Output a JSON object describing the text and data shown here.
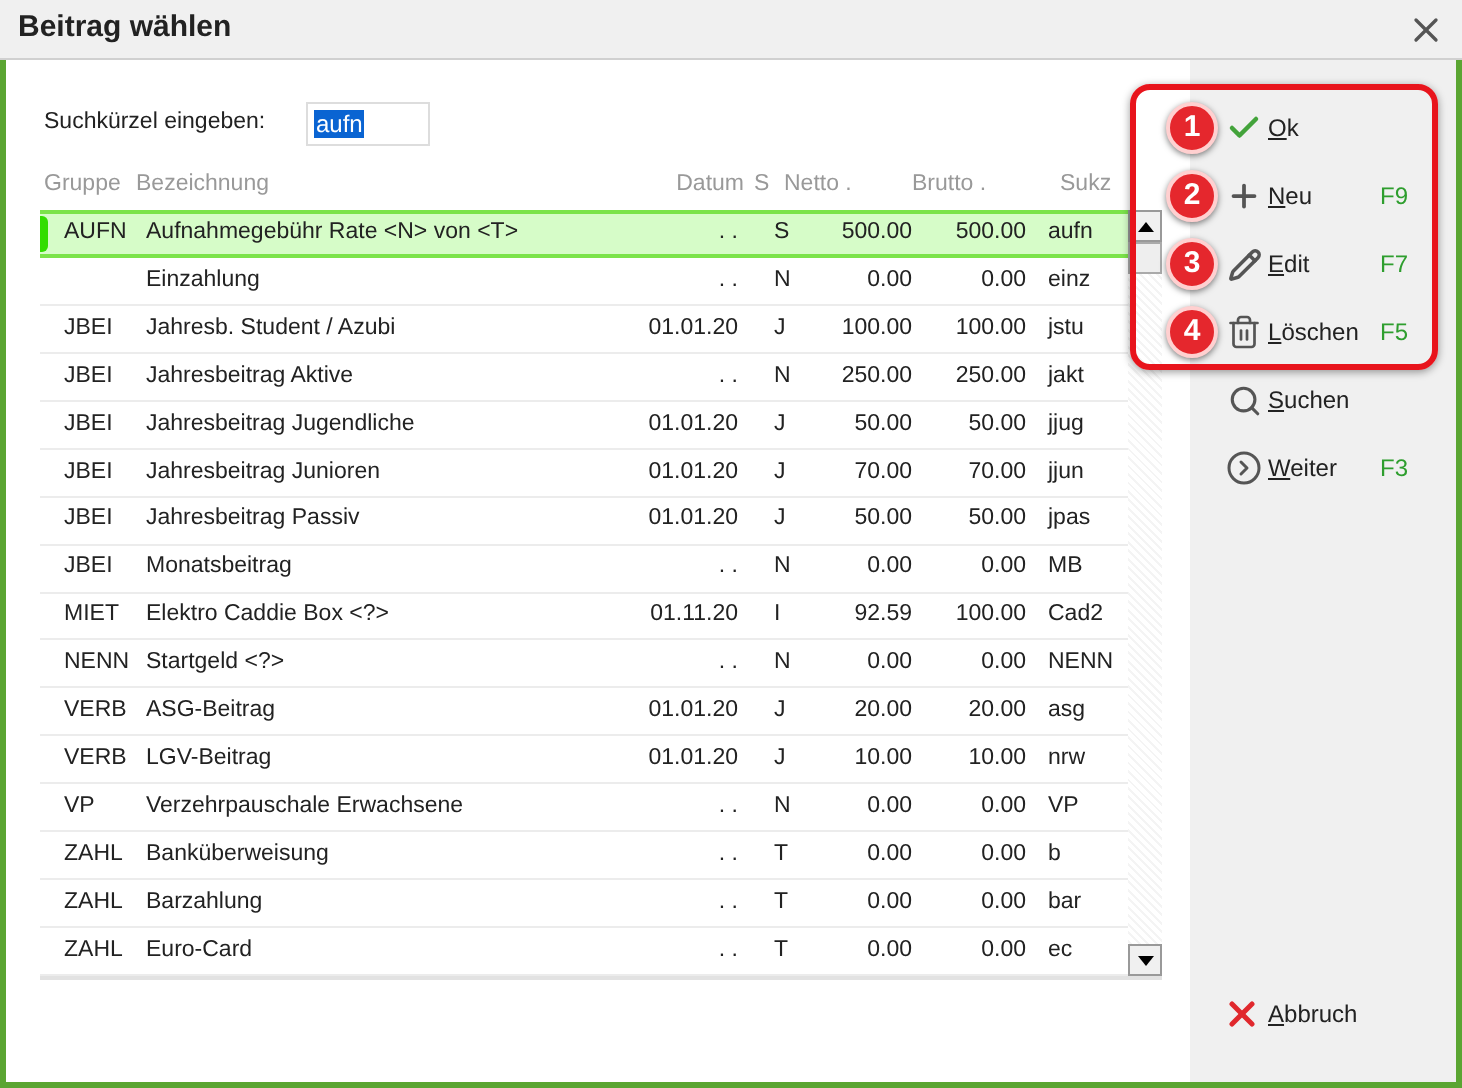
{
  "window": {
    "title": "Beitrag wählen"
  },
  "search": {
    "label": "Suchkürzel eingeben:",
    "value": "aufn"
  },
  "table": {
    "columns": [
      "Gruppe",
      "Bezeichnung",
      "Datum",
      "S",
      "Netto .",
      "Brutto .",
      "Sukz"
    ],
    "rows": [
      {
        "selected": true,
        "cells": [
          "AUFN",
          "Aufnahmegebühr Rate <N> von <T>",
          ". .",
          "S",
          "500.00",
          "500.00",
          "aufn"
        ]
      },
      {
        "selected": false,
        "cells": [
          "",
          "Einzahlung",
          ". .",
          "N",
          "0.00",
          "0.00",
          "einz"
        ]
      },
      {
        "selected": false,
        "cells": [
          "JBEI",
          "Jahresb. Student / Azubi",
          "01.01.20",
          "J",
          "100.00",
          "100.00",
          "jstu"
        ]
      },
      {
        "selected": false,
        "cells": [
          "JBEI",
          "Jahresbeitrag Aktive",
          ". .",
          "N",
          "250.00",
          "250.00",
          "jakt"
        ]
      },
      {
        "selected": false,
        "cells": [
          "JBEI",
          "Jahresbeitrag Jugendliche",
          "01.01.20",
          "J",
          "50.00",
          "50.00",
          "jjug"
        ]
      },
      {
        "selected": false,
        "cells": [
          "JBEI",
          "Jahresbeitrag Junioren",
          "01.01.20",
          "J",
          "70.00",
          "70.00",
          "jjun"
        ]
      },
      {
        "selected": false,
        "cells": [
          "JBEI",
          "Jahresbeitrag Passiv",
          "01.01.20",
          "J",
          "50.00",
          "50.00",
          "jpas"
        ]
      },
      {
        "selected": false,
        "cells": [
          "JBEI",
          "Monatsbeitrag",
          ". .",
          "N",
          "0.00",
          "0.00",
          "MB"
        ]
      },
      {
        "selected": false,
        "cells": [
          "MIET",
          "Elektro Caddie Box <?>",
          "01.11.20",
          "I",
          "92.59",
          "100.00",
          "Cad2"
        ]
      },
      {
        "selected": false,
        "cells": [
          "NENN",
          "Startgeld <?>",
          ". .",
          "N",
          "0.00",
          "0.00",
          "NENN"
        ]
      },
      {
        "selected": false,
        "cells": [
          "VERB",
          "ASG-Beitrag",
          "01.01.20",
          "J",
          "20.00",
          "20.00",
          "asg"
        ]
      },
      {
        "selected": false,
        "cells": [
          "VERB",
          "LGV-Beitrag",
          "01.01.20",
          "J",
          "10.00",
          "10.00",
          "nrw"
        ]
      },
      {
        "selected": false,
        "cells": [
          "VP",
          "Verzehrpauschale Erwachsene",
          ". .",
          "N",
          "0.00",
          "0.00",
          "VP"
        ]
      },
      {
        "selected": false,
        "cells": [
          "ZAHL",
          "Banküberweisung",
          ". .",
          "T",
          "0.00",
          "0.00",
          "b"
        ]
      },
      {
        "selected": false,
        "cells": [
          "ZAHL",
          "Barzahlung",
          ". .",
          "T",
          "0.00",
          "0.00",
          "bar"
        ]
      },
      {
        "selected": false,
        "cells": [
          "ZAHL",
          "Euro-Card",
          ". .",
          "T",
          "0.00",
          "0.00",
          "ec"
        ]
      }
    ]
  },
  "actions": [
    {
      "kind": "ok",
      "label": "Ok",
      "badge": "1"
    },
    {
      "kind": "new",
      "label": "Neu",
      "shortcut": "F9",
      "badge": "2"
    },
    {
      "kind": "edit",
      "label": "Edit",
      "shortcut": "F7",
      "badge": "3"
    },
    {
      "kind": "delete",
      "label": "Löschen",
      "shortcut": "F5",
      "badge": "4"
    },
    {
      "kind": "search",
      "label": "Suchen"
    },
    {
      "kind": "next",
      "label": "Weiter",
      "shortcut": "F3"
    }
  ],
  "cancel": {
    "label": "Abbruch"
  }
}
